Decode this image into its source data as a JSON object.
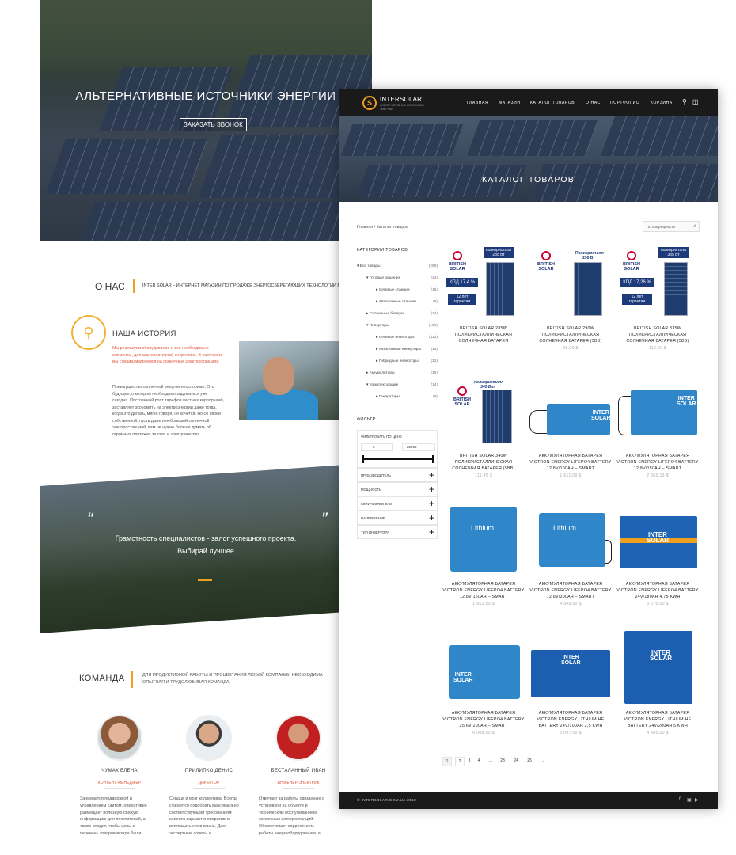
{
  "back_page": {
    "hero": {
      "title": "АЛЬТЕРНАТИВНЫЕ ИСТОЧНИКИ ЭНЕРГИИ",
      "button": "ЗАКАЗАТЬ ЗВОНОК"
    },
    "about": {
      "heading": "О НАС",
      "text": "INTER SOLAR – ИНТЕРНЕТ МАГАЗИН ПО ПРОДАЖЕ ЭНЕРГОСБЕРЕГАЮЩИХ ТЕХНОЛОГИЙ В УКРАИНЕ"
    },
    "story": {
      "heading": "НАША ИСТОРИЯ",
      "highlight": "Мы реализуем оборудование и все необходимые элементы, для альтернативной энергетики. В частности, мы специализируемся на солнечных электростанциях.",
      "text": "Преимущество солнечной энергии неоспоримо. Это будущее, о котором необходимо задуматься уже сегодня. Постоянный рост тарифов частных корпораций, заставляет экономить на электроэнергии даже тогда, когда это делать, мягко говоря, не хочется. Но со своей собственной, пусть даже и небольшой солнечной электростанцией, вам не нужно больше думать об огромных платежах за свет и электричество."
    },
    "quote": {
      "open": "“",
      "close": "”",
      "line1": "Грамотность специалистов - залог успешного проекта.",
      "line2": "Выбирай лучшее"
    },
    "team": {
      "heading": "КОМАНДА",
      "subtitle": "ДЛЯ ПРОДУКТИВНОЙ РАБОТЫ И ПРОЦВЕТАНИЯ ЛЮБОЙ КОМПАНИИ НЕОБХОДИМА ОПЫТНАЯ И ТРУДОЛЮБИВАЯ КОМАНДА.",
      "members": [
        {
          "name": "ЧУМАК ЕЛЕНА",
          "role": "КОНТЕНТ-МЕНЕДЖЕР",
          "desc": "Занимается поддержкой и управлением сайтом, оперативно размещает полезную свежую информацию для посетителей, а также следит, чтобы цены и перечень товаров всегда были"
        },
        {
          "name": "ПРИЛИПКО ДЕНИС",
          "role": "ДИРЕКТОР",
          "desc": "Сердце и мозг коллектива. Всегда старается подобрать максимально соответствующий требованиям клиента вариант и оперативно воплощать его в жизнь. Даст экспертные советы и"
        },
        {
          "name": "БЕСТАЛАННЫЙ ИВАН",
          "role": "ИНЖЕНЕР-ЭЛЕКТРИК",
          "desc": "Отвечает за работы связанные с установкой на объекте и техническим обслуживанием солнечных электростанций. Обеспечивает корректность работы энергооборудования, а"
        }
      ]
    }
  },
  "front_page": {
    "logo": {
      "mark": "S",
      "title": "INTERSOLAR",
      "subtitle": "АЛЬТЕРНАТИВНЫЕ ИСТОЧНИКИ ЭНЕРГИИ"
    },
    "nav": [
      "ГЛАВНАЯ",
      "МАГАЗИН",
      "КАТАЛОГ ТОВАРОВ",
      "О НАС",
      "ПОРТФОЛИО",
      "КОРЗИНА"
    ],
    "banner_title": "КАТАЛОГ ТОВАРОВ",
    "breadcrumb": {
      "home": "Главная",
      "sep": " / ",
      "current": "Каталог товаров"
    },
    "sort": {
      "selected": "По популярности"
    },
    "categories_heading": "КАТЕГОРИИ ТОВАРОВ",
    "categories": [
      {
        "label": "Все товары",
        "count": "(289)"
      },
      {
        "label": "Готовые решения",
        "count": "(24)"
      },
      {
        "label": "Сетевые станции",
        "count": "(16)"
      },
      {
        "label": "Автономные станции",
        "count": "(8)"
      },
      {
        "label": "Солнечные батареи",
        "count": "(74)"
      },
      {
        "label": "Инверторы",
        "count": "(139)"
      },
      {
        "label": "Сетевые инверторы",
        "count": "(112)"
      },
      {
        "label": "Автономные инверторы",
        "count": "(15)"
      },
      {
        "label": "Гибридные инверторы",
        "count": "(12)"
      },
      {
        "label": "Аккумуляторы",
        "count": "(15)"
      },
      {
        "label": "Комплектующие",
        "count": "(14)"
      },
      {
        "label": "Генераторы",
        "count": "(9)"
      }
    ],
    "filter": {
      "heading": "ФИЛЬТР",
      "price_label": "ФИЛЬТРОВАТЬ ПО ЦЕНЕ",
      "price_min": "0",
      "price_max": "22950",
      "price_range_fraction": [
        0.0,
        1.0
      ],
      "groups": [
        "ПРОИЗВОДИТЕЛЬ",
        "МОЩНОСТЬ",
        "КОЛИЧЕСТВО ФАЗ",
        "НАПРЯЖЕНИЕ",
        "ТИП ИНВЕРТОРА"
      ]
    },
    "products": [
      {
        "name": "BRITISH SOLAR 285W ПОЛИКРИСТАЛЛИЧЕСКАЯ СОЛНЕЧНАЯ БАТАРЕЯ",
        "price": "",
        "tag": "поликристалл 285 Вт",
        "kpd": "КПД 17,4 %",
        "warranty": "12 лет гарантии"
      },
      {
        "name": "BRITISH SOLAR 290W ПОЛИКРИСТАЛЛИЧЕСКАЯ СОЛНЕЧНАЯ БАТАРЕЯ (5BB)",
        "price": "95.00 $",
        "tag": "Поликристалл 290 Вт"
      },
      {
        "name": "BRITISH SOLAR 335W ПОЛИКРИСТАЛЛИЧЕСКАЯ СОЛНЕЧНАЯ БАТАРЕЯ (5BB)",
        "price": "110.00 $",
        "tag": "поликристалл 335 Вт",
        "kpd": "КПД 17,26 %",
        "warranty": "12 лет гарантии"
      },
      {
        "name": "BRITISH SOLAR 340W ПОЛИКРИСТАЛЛИЧЕСКАЯ СОЛНЕЧНАЯ БАТАРЕЯ (5BB)",
        "price": "111.45 $",
        "tag": "поликристалл 340 Вт"
      },
      {
        "name": "АККУМУЛЯТОРНАЯ БАТАРЕЯ VICTRON ENERGY LIFEPO4 BATTERY 12,8V/100AH – SMART",
        "price": "1 611.00 $"
      },
      {
        "name": "АККУМУЛЯТОРНАЯ БАТАРЕЯ VICTRON ENERGY LIFEPO4 BATTERY 12,8V/150AH – SMART",
        "price": "2 355.13 $"
      },
      {
        "name": "АККУМУЛЯТОРНАЯ БАТАРЕЯ VICTRON ENERGY LIFEPO4 BATTERY 12,8V/160AH – SMART",
        "price": "1 952.50 $"
      },
      {
        "name": "АККУМУЛЯТОРНАЯ БАТАРЕЯ VICTRON ENERGY LIFEPO4 BATTERY 12,8V/300AH – SMART",
        "price": "4 508.00 $"
      },
      {
        "name": "АККУМУЛЯТОРНАЯ БАТАРЕЯ VICTRON ENERGY LIFEPO4 BATTERY 24V/180AH 4,75 KWH",
        "price": "3 675.00 $"
      },
      {
        "name": "АККУМУЛЯТОРНАЯ БАТАРЕЯ VICTRON ENERGY LIFEPO4 BATTERY 25,6V/200AH – SMART",
        "price": "6 008.00 $"
      },
      {
        "name": "АККУМУЛЯТОРНАЯ БАТАРЕЯ VICTRON ENERGY LITHIUM HE BATTERY 24V/100AH 2,5 KWH",
        "price": "3 097.00 $"
      },
      {
        "name": "АККУМУЛЯТОРНАЯ БАТАРЕЯ VICTRON ENERGY LITHIUM HE BATTERY 24V/200AH 5 KWH",
        "price": "4 985.00 $"
      }
    ],
    "brand": {
      "british1": "BRITISH",
      "british2": "SOLAR",
      "inter1": "INTER",
      "inter2": "SOLAR",
      "lithium": "Lithium"
    },
    "pagination": [
      "1",
      "2",
      "3",
      "4",
      "...",
      "23",
      "24",
      "25",
      "→"
    ],
    "footer": {
      "copyright": "© INTERSOLAR.COM.UA 2018"
    },
    "colors": {
      "accent": "#f0a020",
      "dark": "#1a1a1a",
      "battery": "#2f86c8"
    }
  }
}
